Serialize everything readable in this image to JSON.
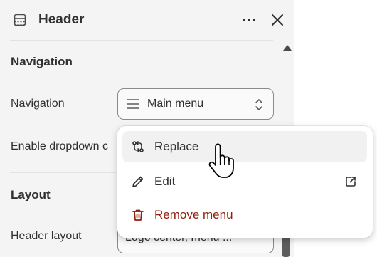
{
  "panel": {
    "title": "Header",
    "icons": {
      "header": "section-layout-icon",
      "more": "more-horizontal-icon",
      "close": "close-icon"
    }
  },
  "navigation": {
    "section_title": "Navigation",
    "menu_label": "Navigation",
    "menu_value": "Main menu",
    "dropdown_label": "Enable dropdown c"
  },
  "layout": {
    "section_title": "Layout",
    "header_layout_label": "Header layout",
    "header_layout_value": "Logo center, menu ..."
  },
  "menu_popover": {
    "items": [
      {
        "label": "Replace",
        "icon": "replace-icon",
        "state": "hovered"
      },
      {
        "label": "Edit",
        "icon": "pencil-icon",
        "trailing_icon": "external-link-icon"
      },
      {
        "label": "Remove menu",
        "icon": "trash-icon",
        "tone": "critical"
      }
    ]
  },
  "colors": {
    "critical": "#8e1f0b",
    "text": "#303030",
    "panel_bg": "#f4f4f4"
  }
}
